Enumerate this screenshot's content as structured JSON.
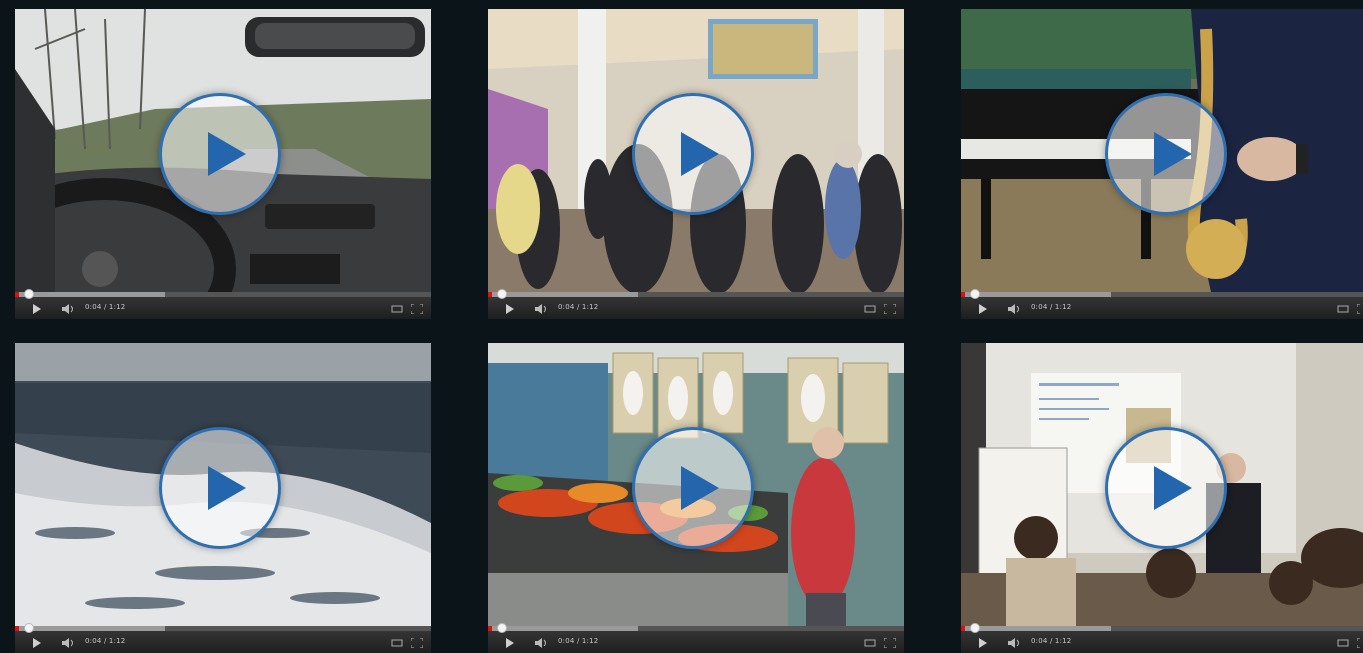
{
  "videos": [
    {
      "scene": "car-drive",
      "time": "0:04 / 1:12",
      "progress": 0.01,
      "buffered": 0.36
    },
    {
      "scene": "station-crowd",
      "time": "0:04 / 1:12",
      "progress": 0.01,
      "buffered": 0.36
    },
    {
      "scene": "saxophone-piano",
      "time": "0:04 / 1:12",
      "progress": 0.01,
      "buffered": 0.36
    },
    {
      "scene": "sea-wake",
      "time": "0:04 / 1:12",
      "progress": 0.01,
      "buffered": 0.36
    },
    {
      "scene": "market-hall",
      "time": "0:04 / 1:12",
      "progress": 0.01,
      "buffered": 0.36
    },
    {
      "scene": "presentation-room",
      "time": "0:04 / 1:12",
      "progress": 0.01,
      "buffered": 0.36
    }
  ],
  "colors": {
    "page_bg": "#0b1419",
    "play_ring": "#2f6fb0",
    "play_arrow": "#2466ad",
    "progress_played": "#dd1111"
  },
  "icons": {
    "play_overlay": "play-circle-icon",
    "play": "play-icon",
    "volume": "volume-icon",
    "loop": "loop-icon",
    "fullscreen": "fullscreen-icon"
  }
}
